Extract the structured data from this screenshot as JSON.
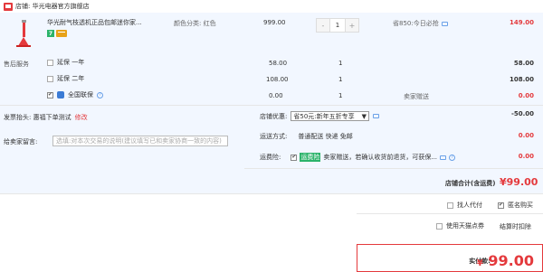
{
  "shop": {
    "name": "店铺: 华光电器官方旗舰店"
  },
  "product": {
    "title": "华光耐气枝透机正品包邮迷你家... ",
    "color_label": "颜色分类: 红色",
    "unit_price": "999.00",
    "quantity": "1",
    "qty_minus": "-",
    "qty_plus": "+",
    "promo": "省850:今日必抢",
    "subtotal": "149.00",
    "badge7": "7"
  },
  "service": {
    "label": "售后服务",
    "items": [
      {
        "name": "延保 一年",
        "price": "58.00",
        "qty": "1",
        "subtotal": "58.00",
        "checked": false
      },
      {
        "name": "延保 二年",
        "price": "108.00",
        "qty": "1",
        "subtotal": "108.00",
        "checked": false
      },
      {
        "name": "全国联保",
        "price": "0.00",
        "qty": "1",
        "note": "卖家赠送",
        "subtotal": "0.00",
        "checked": true
      }
    ]
  },
  "invoice": {
    "label": "发票抬头: 惠福下单测试",
    "action": "修改"
  },
  "coupon": {
    "label": "店铺优惠:",
    "selected": "省50元:新年五折专享",
    "amount": "-50.00"
  },
  "shipping": {
    "label": "运送方式:",
    "value": "普通配送 快递 免邮",
    "price": "0.00"
  },
  "message": {
    "label": "给卖家留言:",
    "placeholder": "选填:对本次交易的说明(建议填写已和卖家协商一致的内容)"
  },
  "insurance": {
    "label": "运费险:",
    "tag": "运费险",
    "text": "卖家赠送，若确认收货前退货，可获保...",
    "price": "0.00"
  },
  "shop_total": {
    "label": "店铺合计(含运费)",
    "amount": "¥99.00"
  },
  "options": {
    "proxy_pay": "找人代付",
    "anonymous": "匿名购买",
    "tmall_points": "使用天猫点券",
    "checkout_discount": "结算时扣除"
  },
  "payment": {
    "label": "实付款:",
    "currency": "¥",
    "amount": "99.00"
  },
  "colors": {
    "accent_red": "#e4393c",
    "band_blue": "#f2f7ff"
  }
}
